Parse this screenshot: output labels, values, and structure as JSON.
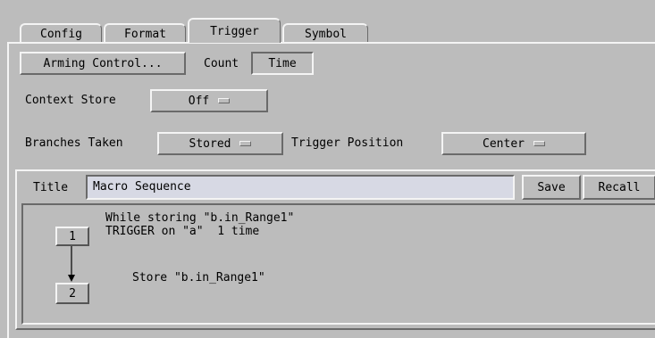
{
  "tabs": [
    {
      "label": "Config",
      "active": false
    },
    {
      "label": "Format",
      "active": false
    },
    {
      "label": "Trigger",
      "active": true
    },
    {
      "label": "Symbol",
      "active": false
    }
  ],
  "toolbar": {
    "arming_control_label": "Arming Control...",
    "count_label": "Count",
    "count_value": "Time"
  },
  "context_store": {
    "label": "Context Store",
    "value": "Off"
  },
  "branches_taken": {
    "label": "Branches Taken",
    "value": "Stored"
  },
  "trigger_position": {
    "label": "Trigger Position",
    "value": "Center"
  },
  "sequence": {
    "title_label": "Title",
    "title_value": "Macro Sequence",
    "save_label": "Save",
    "recall_label": "Recall",
    "steps": [
      {
        "number": "1",
        "lines": [
          "While storing \"b.in_Range1\"",
          "TRIGGER on \"a\"  1 time"
        ]
      },
      {
        "number": "2",
        "lines": [
          "Store \"b.in_Range1\""
        ]
      }
    ]
  }
}
